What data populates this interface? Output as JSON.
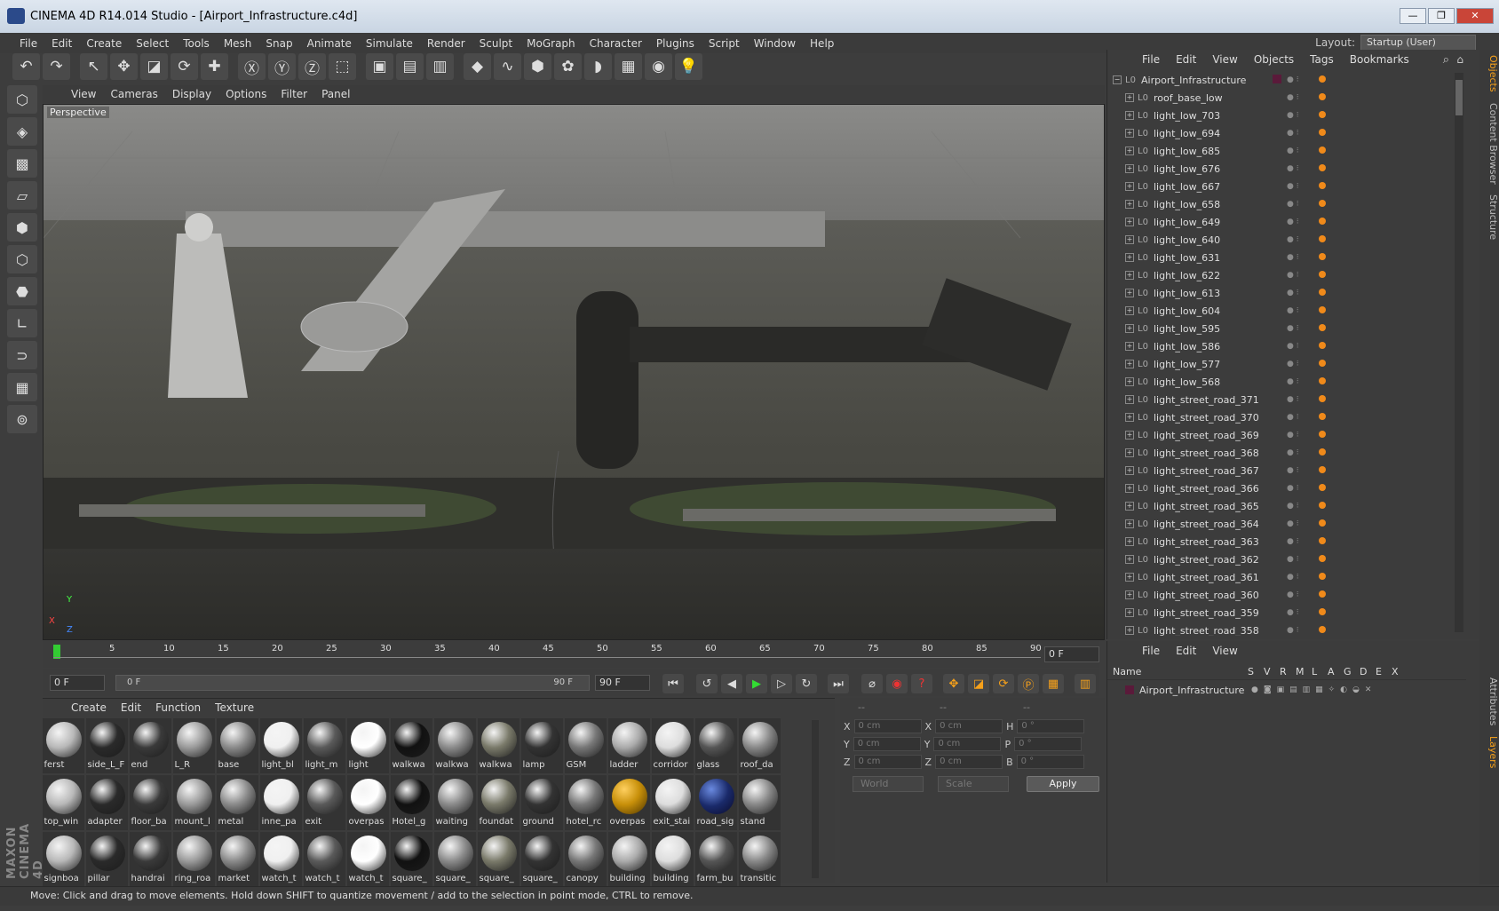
{
  "window": {
    "title": "CINEMA 4D R14.014 Studio - [Airport_Infrastructure.c4d]",
    "buttons": [
      "—",
      "❐",
      "✕"
    ]
  },
  "menu": [
    "File",
    "Edit",
    "Create",
    "Select",
    "Tools",
    "Mesh",
    "Snap",
    "Animate",
    "Simulate",
    "Render",
    "Sculpt",
    "MoGraph",
    "Character",
    "Plugins",
    "Script",
    "Window",
    "Help"
  ],
  "layout": {
    "label": "Layout:",
    "value": "Startup (User)"
  },
  "viewport": {
    "menu": [
      "View",
      "Cameras",
      "Display",
      "Options",
      "Filter",
      "Panel"
    ],
    "label": "Perspective",
    "axis_y": "Y",
    "axis_x": "X",
    "axis_z": "Z"
  },
  "timeline": {
    "ticks": [
      "0",
      "5",
      "10",
      "15",
      "20",
      "25",
      "30",
      "35",
      "40",
      "45",
      "50",
      "55",
      "60",
      "65",
      "70",
      "75",
      "80",
      "85",
      "90"
    ],
    "current_frame": "0 F",
    "start_frame": "0 F",
    "slider_start": "0 F",
    "slider_end": "90 F",
    "end_frame": "90 F"
  },
  "material_menu": [
    "Create",
    "Edit",
    "Function",
    "Texture"
  ],
  "materials": [
    "ferst",
    "side_L_F",
    "end",
    "L_R",
    "base",
    "light_bl",
    "light_m",
    "light",
    "walkwa",
    "walkwa",
    "walkwa",
    "lamp",
    "GSM",
    "ladder",
    "corridor",
    "glass",
    "roof_da",
    "top_win",
    "adapter",
    "floor_ba",
    "mount_l",
    "metal",
    "inne_pa",
    "exit",
    "overpas",
    "Hotel_g",
    "waiting",
    "foundat",
    "ground",
    "hotel_rc",
    "overpas",
    "exit_stai",
    "road_sig",
    "stand",
    "signboa",
    "pillar",
    "handrai",
    "ring_roa",
    "market",
    "watch_t",
    "watch_t",
    "watch_t",
    "square_",
    "square_",
    "square_",
    "square_",
    "canopy",
    "building",
    "building",
    "farm_bu",
    "transitic"
  ],
  "coords": {
    "headers": [
      "--",
      "--",
      "--"
    ],
    "rows": [
      {
        "a": "X",
        "av": "0 cm",
        "b": "X",
        "bv": "0 cm",
        "c": "H",
        "cv": "0 °"
      },
      {
        "a": "Y",
        "av": "0 cm",
        "b": "Y",
        "bv": "0 cm",
        "c": "P",
        "cv": "0 °"
      },
      {
        "a": "Z",
        "av": "0 cm",
        "b": "Z",
        "bv": "0 cm",
        "c": "B",
        "cv": "0 °"
      }
    ],
    "world": "World",
    "scale": "Scale",
    "apply": "Apply"
  },
  "objects_menu": [
    "File",
    "Edit",
    "View",
    "Objects",
    "Tags",
    "Bookmarks"
  ],
  "objects": [
    "Airport_Infrastructure",
    "roof_base_low",
    "light_low_703",
    "light_low_694",
    "light_low_685",
    "light_low_676",
    "light_low_667",
    "light_low_658",
    "light_low_649",
    "light_low_640",
    "light_low_631",
    "light_low_622",
    "light_low_613",
    "light_low_604",
    "light_low_595",
    "light_low_586",
    "light_low_577",
    "light_low_568",
    "light_street_road_371",
    "light_street_road_370",
    "light_street_road_369",
    "light_street_road_368",
    "light_street_road_367",
    "light_street_road_366",
    "light_street_road_365",
    "light_street_road_364",
    "light_street_road_363",
    "light_street_road_362",
    "light_street_road_361",
    "light_street_road_360",
    "light_street_road_359",
    "light_street_road_358"
  ],
  "side_tabs": [
    "Objects",
    "Content Browser",
    "Structure",
    "Attributes",
    "Layers"
  ],
  "layers": {
    "menu": [
      "File",
      "Edit",
      "View"
    ],
    "headers": [
      "Name",
      "S",
      "V",
      "R",
      "M",
      "L",
      "A",
      "G",
      "D",
      "E",
      "X"
    ],
    "row_name": "Airport_Infrastructure"
  },
  "status": "Move: Click and drag to move elements. Hold down SHIFT to quantize movement / add to the selection in point mode, CTRL to remove.",
  "colors": {
    "accent": "#f7a11a",
    "root_swatch": "#5a1a3a",
    "tag": "#f08a1a"
  }
}
